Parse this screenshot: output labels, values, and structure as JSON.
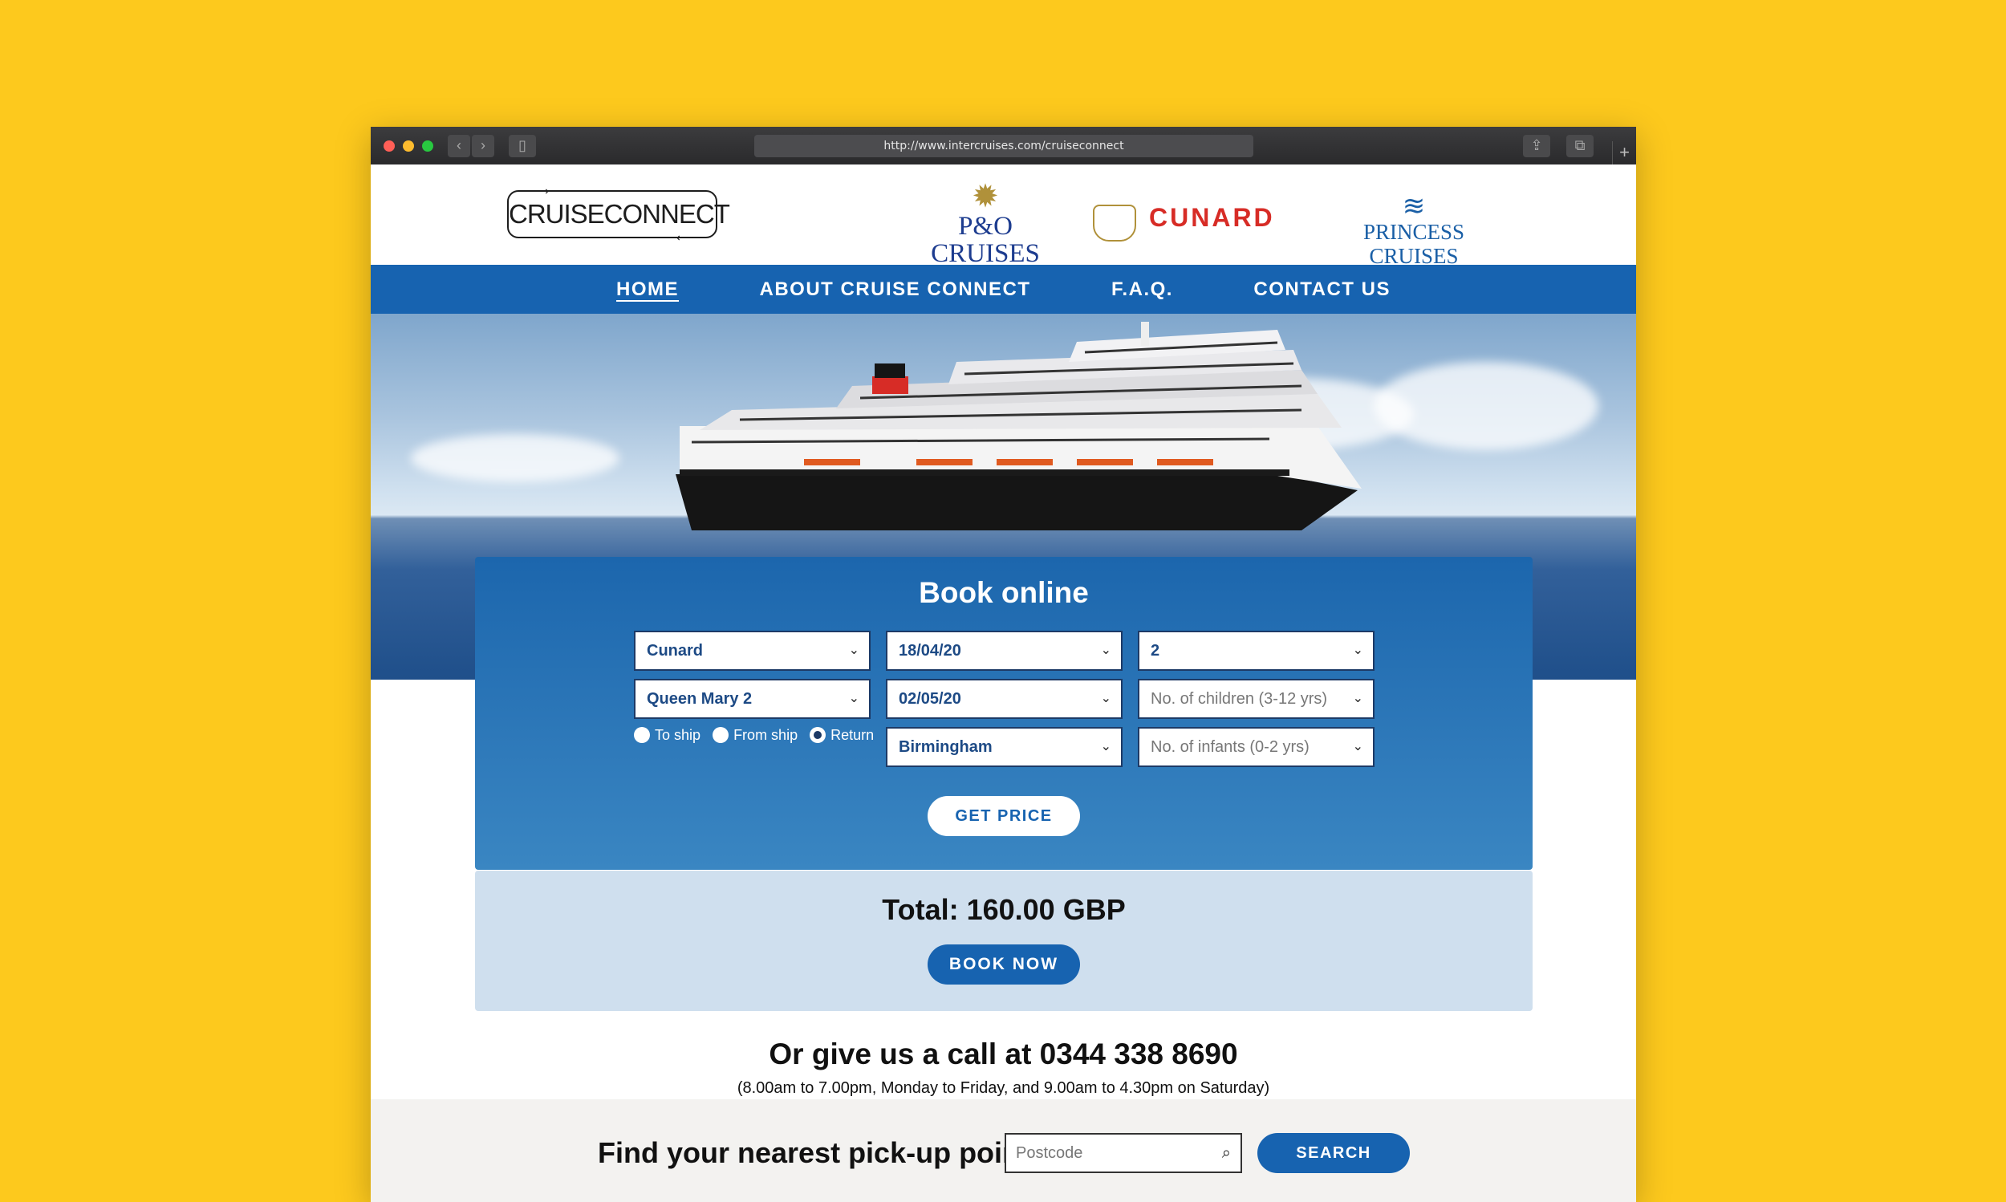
{
  "browser": {
    "url": "http://www.intercruises.com/cruiseconnect",
    "plus": "+"
  },
  "logos": {
    "cruiseconnect": "CRUISECONNECT",
    "po": "P&O CRUISES",
    "cunard": "CUNARD",
    "princess": "PRINCESS CRUISES"
  },
  "nav": {
    "items": [
      "HOME",
      "ABOUT CRUISE CONNECT",
      "F.A.Q.",
      "CONTACT US"
    ],
    "active": "HOME"
  },
  "booking": {
    "title": "Book online",
    "cruise_line": "Cunard",
    "ship": "Queen Mary 2",
    "date_out": "18/04/20",
    "date_return": "02/05/20",
    "adults": "2",
    "children_placeholder": "No. of children (3-12 yrs)",
    "infants_placeholder": "No. of infants (0-2 yrs)",
    "departure": "Birmingham",
    "trip_options": [
      "To ship",
      "From ship",
      "Return"
    ],
    "trip_selected": "Return",
    "get_price": "GET PRICE"
  },
  "total": {
    "label": "Total: 160.00 GBP",
    "book_now": "BOOK NOW"
  },
  "call": {
    "heading": "Or give us a call at 0344 338 8690",
    "hours": "(8.00am to 7.00pm, Monday to Friday, and 9.00am to 4.30pm on Saturday)"
  },
  "pickup": {
    "label": "Find your nearest pick-up point",
    "placeholder": "Postcode",
    "search": "SEARCH"
  },
  "colors": {
    "page_bg": "#FDC91D",
    "brand_blue": "#1763b0",
    "cunard_red": "#d72c26"
  }
}
